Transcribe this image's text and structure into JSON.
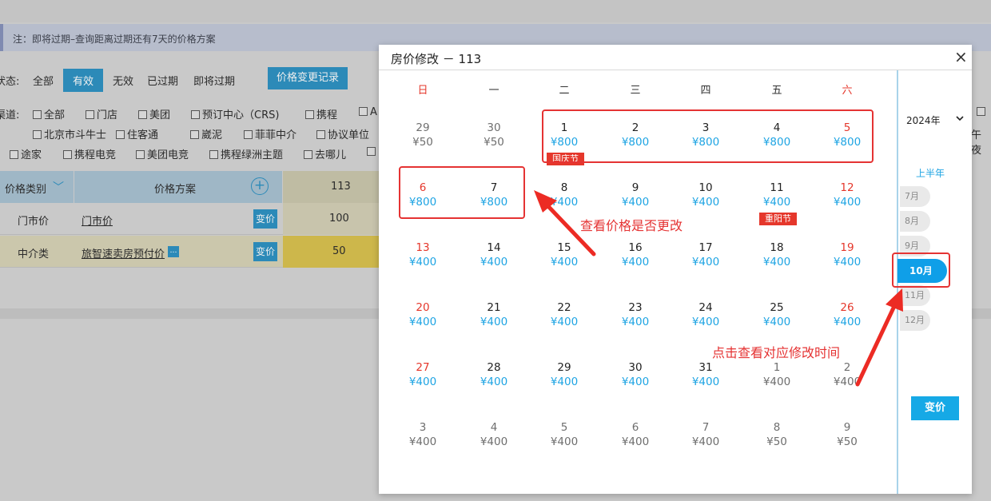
{
  "background": {
    "notice": "注：即将过期–查询距离过期还有7天的价格方案",
    "status_label": "状态:",
    "status_options": [
      "全部",
      "有效",
      "无效",
      "已过期",
      "即将过期"
    ],
    "history_button": "价格变更记录",
    "channel_label": "渠道:",
    "channels_row1": [
      "全部",
      "门店",
      "美团",
      "预订中心（CRS)",
      "携程",
      "A"
    ],
    "channels_row2": [
      "北京市斗牛士",
      "住客通",
      "崴泥",
      "菲菲中介",
      "协议单位"
    ],
    "channels_row3": [
      "途家",
      "携程电竞",
      "美团电竞",
      "携程绿洲主题",
      "去哪儿"
    ],
    "right_fragment": "午夜",
    "table": {
      "headers": [
        "价格类别",
        "价格方案",
        "113"
      ],
      "rows": [
        {
          "category": "门市价",
          "plan": "门市价",
          "button": "变价",
          "value": "100"
        },
        {
          "category": "中介类",
          "plan": "旅智速卖房预付价",
          "button": "变价",
          "value": "50"
        }
      ]
    }
  },
  "modal": {
    "title": "房价修改 － 113",
    "close": "×",
    "weekdays": [
      "日",
      "一",
      "二",
      "三",
      "四",
      "五",
      "六"
    ],
    "weeks": [
      [
        {
          "d": "29",
          "p": "¥50",
          "other": true
        },
        {
          "d": "30",
          "p": "¥50",
          "other": true
        },
        {
          "d": "1",
          "p": "¥800",
          "holiday": "国庆节"
        },
        {
          "d": "2",
          "p": "¥800"
        },
        {
          "d": "3",
          "p": "¥800"
        },
        {
          "d": "4",
          "p": "¥800"
        },
        {
          "d": "5",
          "p": "¥800"
        }
      ],
      [
        {
          "d": "6",
          "p": "¥800"
        },
        {
          "d": "7",
          "p": "¥800"
        },
        {
          "d": "8",
          "p": "¥400"
        },
        {
          "d": "9",
          "p": "¥400"
        },
        {
          "d": "10",
          "p": "¥400"
        },
        {
          "d": "11",
          "p": "¥400",
          "holiday": "重阳节"
        },
        {
          "d": "12",
          "p": "¥400"
        }
      ],
      [
        {
          "d": "13",
          "p": "¥400"
        },
        {
          "d": "14",
          "p": "¥400"
        },
        {
          "d": "15",
          "p": "¥400"
        },
        {
          "d": "16",
          "p": "¥400"
        },
        {
          "d": "17",
          "p": "¥400"
        },
        {
          "d": "18",
          "p": "¥400"
        },
        {
          "d": "19",
          "p": "¥400"
        }
      ],
      [
        {
          "d": "20",
          "p": "¥400"
        },
        {
          "d": "21",
          "p": "¥400"
        },
        {
          "d": "22",
          "p": "¥400"
        },
        {
          "d": "23",
          "p": "¥400"
        },
        {
          "d": "24",
          "p": "¥400"
        },
        {
          "d": "25",
          "p": "¥400"
        },
        {
          "d": "26",
          "p": "¥400"
        }
      ],
      [
        {
          "d": "27",
          "p": "¥400"
        },
        {
          "d": "28",
          "p": "¥400"
        },
        {
          "d": "29",
          "p": "¥400"
        },
        {
          "d": "30",
          "p": "¥400"
        },
        {
          "d": "31",
          "p": "¥400"
        },
        {
          "d": "1",
          "p": "¥400",
          "other": true
        },
        {
          "d": "2",
          "p": "¥400",
          "other": true
        }
      ],
      [
        {
          "d": "3",
          "p": "¥400",
          "other": true
        },
        {
          "d": "4",
          "p": "¥400",
          "other": true
        },
        {
          "d": "5",
          "p": "¥400",
          "other": true
        },
        {
          "d": "6",
          "p": "¥400",
          "other": true
        },
        {
          "d": "7",
          "p": "¥400",
          "other": true
        },
        {
          "d": "8",
          "p": "¥50",
          "other": true
        },
        {
          "d": "9",
          "p": "¥50",
          "other": true
        }
      ]
    ],
    "side": {
      "year": "2024年",
      "half_label": "上半年",
      "months": [
        "7月",
        "8月",
        "9月",
        "10月",
        "11月",
        "12月"
      ],
      "active_month": "10月",
      "change_button": "变价"
    },
    "annotations": {
      "check_price": "查看价格是否更改",
      "click_month": "点击查看对应修改时间"
    }
  }
}
